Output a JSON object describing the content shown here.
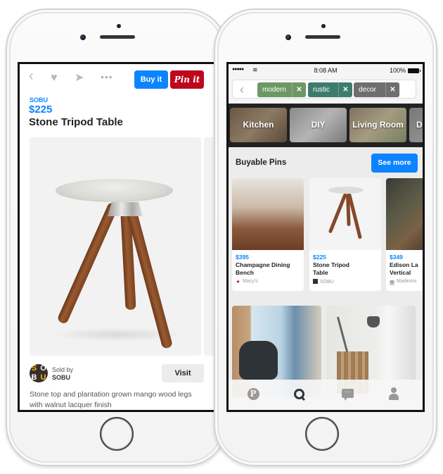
{
  "left_phone": {
    "toolbar": {
      "back_icon": "chevron-left-icon",
      "heart_icon": "heart-icon",
      "send_icon": "send-icon",
      "more_icon": "more-icon",
      "buy_label": "Buy it",
      "pin_label": "Pin it"
    },
    "product": {
      "brand": "SOBU",
      "price": "$225",
      "title": "Stone Tripod Table"
    },
    "seller": {
      "avatar_letters": [
        "S",
        "O",
        "B",
        "U"
      ],
      "sold_by_label": "Sold by",
      "name": "SOBU",
      "visit_label": "Visit"
    },
    "description": "Stone top and plantation grown mango wood legs with walnut lacquer finish"
  },
  "right_phone": {
    "status_bar": {
      "signal": "●●●●●",
      "wifi_icon": "wifi-icon",
      "time": "8:08 AM",
      "battery": "100%"
    },
    "search": {
      "back_icon": "chevron-left-icon",
      "chips": [
        {
          "label": "modern",
          "color": "#6d9863"
        },
        {
          "label": "rustic",
          "color": "#3e7b6f"
        },
        {
          "label": "decor",
          "color": "#6e6e6e"
        }
      ],
      "chip_remove": "✕"
    },
    "categories": [
      "Kitchen",
      "DIY",
      "Living Room",
      "D"
    ],
    "buyable": {
      "title": "Buyable Pins",
      "see_more_label": "See more",
      "pins": [
        {
          "price": "$395",
          "title_line1": "Champagne Dining",
          "title_line2": "Bench",
          "seller_icon": "★",
          "seller": "Macy's"
        },
        {
          "price": "$225",
          "title_line1": "Stone Tripod",
          "title_line2": "Table",
          "seller_icon": "",
          "seller": "SOBU"
        },
        {
          "price": "$349",
          "title_line1": "Edison La",
          "title_line2": "Vertical",
          "seller_icon": "M",
          "seller": "Madesmi"
        }
      ]
    },
    "tab_bar": {
      "home_glyph": "P",
      "chat_glyph": "···"
    }
  },
  "colors": {
    "accent_blue": "#0d84ff",
    "pinterest_red": "#bd081c"
  }
}
